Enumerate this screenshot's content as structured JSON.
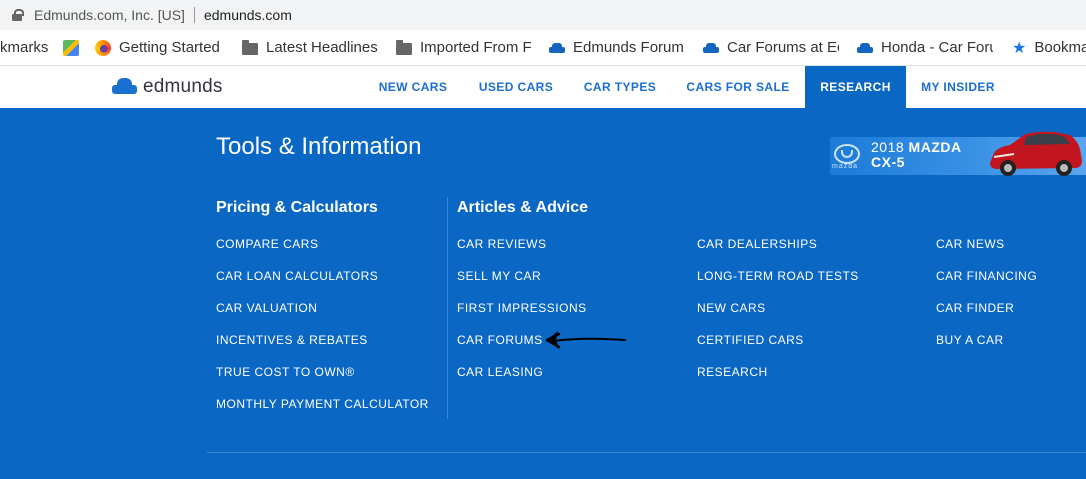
{
  "browser": {
    "site_owner": "Edmunds.com, Inc. [US]",
    "url": "edmunds.com"
  },
  "bookmarks": [
    {
      "label": "kmarks",
      "icon": "none"
    },
    {
      "label": "",
      "icon": "maps-icon"
    },
    {
      "label": "Getting Started",
      "icon": "firefox-icon"
    },
    {
      "label": "Latest Headlines",
      "icon": "folder-icon"
    },
    {
      "label": "Imported From F",
      "icon": "folder-icon"
    },
    {
      "label": "Edmunds Forum",
      "icon": "car-icon"
    },
    {
      "label": "Car Forums at Ec",
      "icon": "car-icon"
    },
    {
      "label": "Honda - Car Foru",
      "icon": "car-icon"
    },
    {
      "label": "Bookma",
      "icon": "star-icon"
    }
  ],
  "site": {
    "logo": "edmunds",
    "nav": [
      {
        "label": "NEW CARS",
        "active": false
      },
      {
        "label": "USED CARS",
        "active": false
      },
      {
        "label": "CAR TYPES",
        "active": false
      },
      {
        "label": "CARS FOR SALE",
        "active": false
      },
      {
        "label": "RESEARCH",
        "active": true
      },
      {
        "label": "MY INSIDER",
        "active": false
      }
    ]
  },
  "menu": {
    "title": "Tools & Information",
    "ad": {
      "year": "2018",
      "make": "MAZDA",
      "model": "CX-5",
      "brand_mark": "mazda"
    },
    "pricing": {
      "heading": "Pricing & Calculators",
      "links": [
        "COMPARE CARS",
        "CAR LOAN CALCULATORS",
        "CAR VALUATION",
        "INCENTIVES & REBATES",
        "TRUE COST TO OWN®",
        "MONTHLY PAYMENT CALCULATOR"
      ]
    },
    "articles": {
      "heading": "Articles & Advice",
      "col1": [
        "CAR REVIEWS",
        "SELL MY CAR",
        "FIRST IMPRESSIONS",
        "CAR FORUMS",
        "CAR LEASING"
      ],
      "col2": [
        "CAR DEALERSHIPS",
        "LONG-TERM ROAD TESTS",
        "NEW CARS",
        "CERTIFIED CARS",
        "RESEARCH"
      ],
      "col3": [
        "CAR NEWS",
        "CAR FINANCING",
        "CAR FINDER",
        "BUY A CAR"
      ]
    }
  },
  "colors": {
    "brand_blue": "#0a67c3",
    "nav_blue": "#1a6fcf"
  }
}
